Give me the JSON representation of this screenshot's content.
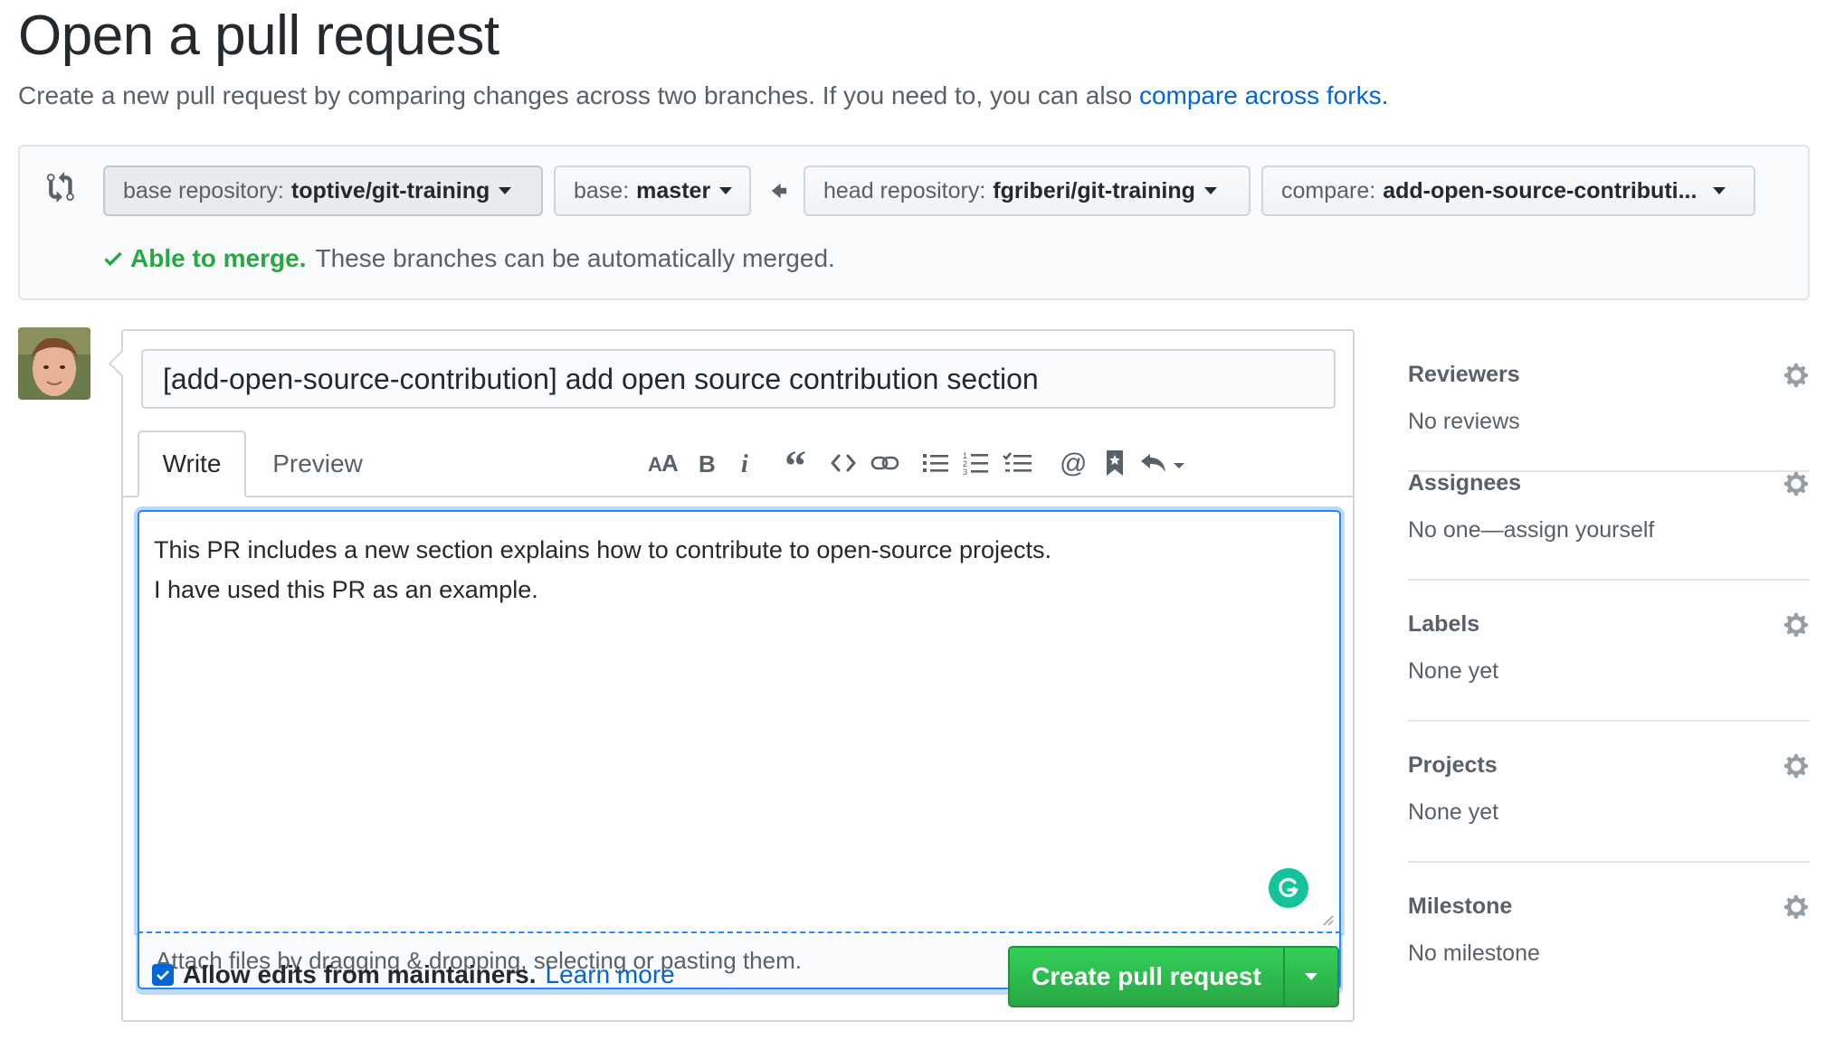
{
  "header": {
    "title": "Open a pull request",
    "subtitle": "Create a new pull request by comparing changes across two branches. If you need to, you can also ",
    "subtitle_link": "compare across forks."
  },
  "range": {
    "base_repository_label": "base repository:",
    "base_repository_value": "toptive/git-training",
    "base_label": "base:",
    "base_value": "master",
    "head_repository_label": "head repository:",
    "head_repository_value": "fgriberi/git-training",
    "compare_label": "compare:",
    "compare_value": "add-open-source-contributi...",
    "merge_ok": "Able to merge.",
    "merge_text": "These branches can be automatically merged."
  },
  "form": {
    "title_value": "[add-open-source-contribution] add open source contribution section",
    "tabs": [
      {
        "label": "Write",
        "selected": true
      },
      {
        "label": "Preview",
        "selected": false
      }
    ],
    "toolbar_icons": [
      "text-size-icon",
      "bold-icon",
      "italic-icon",
      "quote-icon",
      "code-icon",
      "link-icon",
      "bulleted-list-icon",
      "numbered-list-icon",
      "task-list-icon",
      "mention-icon",
      "saved-reply-icon",
      "reply-icon"
    ],
    "body_lines": [
      "This PR includes a new section explains how to contribute to open-source projects.",
      "I have used this PR as an example."
    ],
    "attach_text": "Attach files by dragging & dropping, selecting or pasting them.",
    "allow_edits_label": "Allow edits from maintainers.",
    "learn_more": "Learn more",
    "submit_label": "Create pull request"
  },
  "sidebar": {
    "sections": [
      {
        "heading": "Reviewers",
        "value": "No reviews"
      },
      {
        "heading": "Assignees",
        "value": "No one—assign yourself"
      },
      {
        "heading": "Labels",
        "value": "None yet"
      },
      {
        "heading": "Projects",
        "value": "None yet"
      },
      {
        "heading": "Milestone",
        "value": "No milestone"
      }
    ]
  },
  "colors": {
    "link": "#0366d6",
    "success": "#28a745",
    "focus": "#2188ff"
  }
}
